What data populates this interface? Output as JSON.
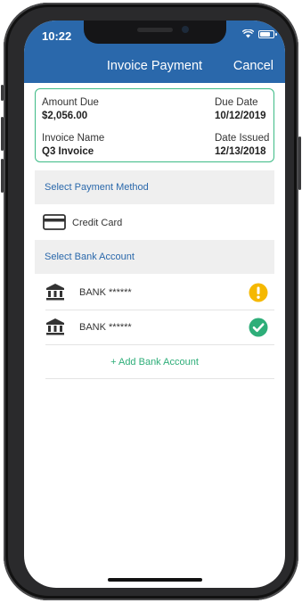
{
  "status": {
    "time": "10:22"
  },
  "nav": {
    "title": "Invoice Payment",
    "cancel": "Cancel"
  },
  "invoice": {
    "amount_label": "Amount Due",
    "amount_value": "$2,056.00",
    "due_label": "Due Date",
    "due_value": "10/12/2019",
    "name_label": "Invoice Name",
    "name_value": "Q3 Invoice",
    "issued_label": "Date Issued",
    "issued_value": "12/13/2018"
  },
  "payment_method": {
    "header": "Select Payment Method",
    "option": "Credit Card"
  },
  "bank_account": {
    "header": "Select Bank Account",
    "accounts": [
      {
        "label": "BANK ******",
        "status": "warning-icon"
      },
      {
        "label": "BANK ******",
        "status": "check-icon"
      }
    ],
    "add_label": "+ Add Bank Account"
  },
  "colors": {
    "brand": "#2a68ab",
    "accent": "#3dbb86",
    "warning": "#f5b800",
    "success": "#2eae79"
  }
}
